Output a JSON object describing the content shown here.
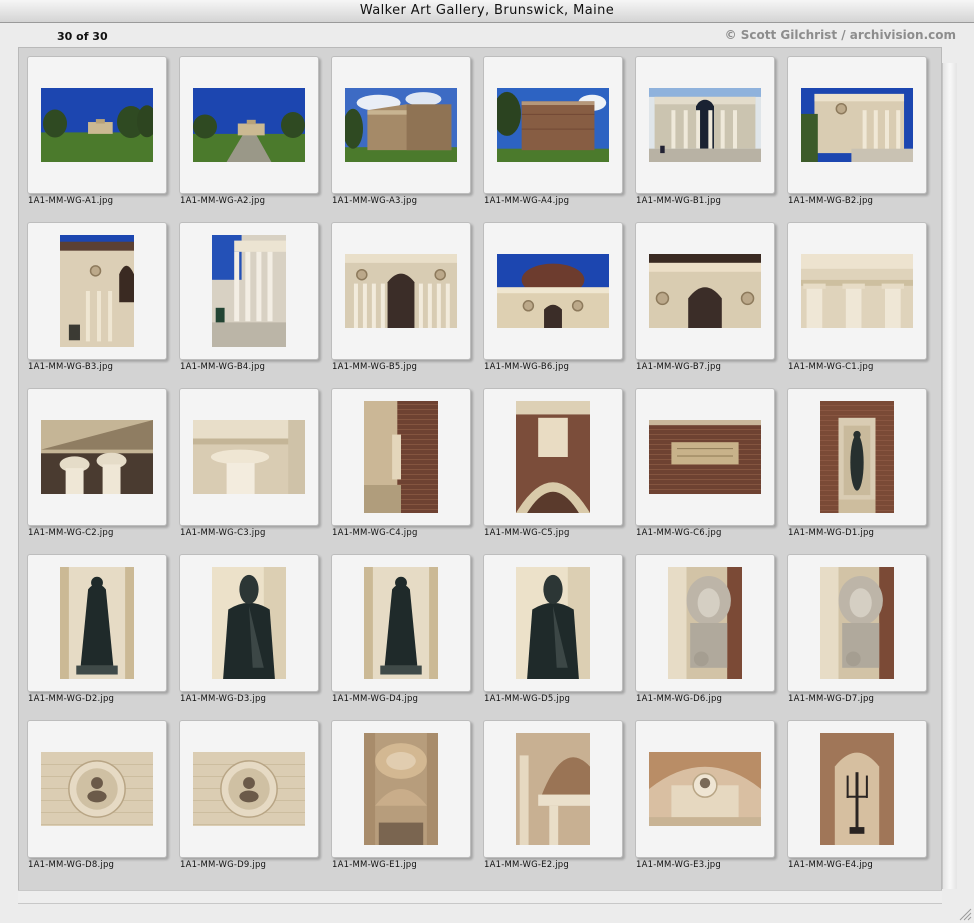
{
  "window": {
    "title": "Walker Art Gallery, Brunswick, Maine"
  },
  "info": {
    "count": "30 of 30",
    "credit": "© Scott Gilchrist / archivision.com"
  },
  "items": [
    {
      "name": "1A1-MM-WG-A1.jpg",
      "orientation": "landscape",
      "subject": "building-distant"
    },
    {
      "name": "1A1-MM-WG-A2.jpg",
      "orientation": "landscape",
      "subject": "building-distant-path"
    },
    {
      "name": "1A1-MM-WG-A3.jpg",
      "orientation": "landscape",
      "subject": "building-corner"
    },
    {
      "name": "1A1-MM-WG-A4.jpg",
      "orientation": "landscape",
      "subject": "building-side"
    },
    {
      "name": "1A1-MM-WG-B1.jpg",
      "orientation": "landscape",
      "subject": "portico-front"
    },
    {
      "name": "1A1-MM-WG-B2.jpg",
      "orientation": "landscape",
      "subject": "portico-angle"
    },
    {
      "name": "1A1-MM-WG-B3.jpg",
      "orientation": "portrait",
      "subject": "portico-side"
    },
    {
      "name": "1A1-MM-WG-B4.jpg",
      "orientation": "portrait",
      "subject": "columns-steps"
    },
    {
      "name": "1A1-MM-WG-B5.jpg",
      "orientation": "landscape",
      "subject": "portico-detail"
    },
    {
      "name": "1A1-MM-WG-B6.jpg",
      "orientation": "landscape",
      "subject": "dome-facade"
    },
    {
      "name": "1A1-MM-WG-B7.jpg",
      "orientation": "landscape",
      "subject": "facade-medallions"
    },
    {
      "name": "1A1-MM-WG-C1.jpg",
      "orientation": "landscape",
      "subject": "capitals"
    },
    {
      "name": "1A1-MM-WG-C2.jpg",
      "orientation": "landscape",
      "subject": "ionic-pair"
    },
    {
      "name": "1A1-MM-WG-C3.jpg",
      "orientation": "landscape",
      "subject": "ionic-single"
    },
    {
      "name": "1A1-MM-WG-C4.jpg",
      "orientation": "portrait",
      "subject": "brick-corner"
    },
    {
      "name": "1A1-MM-WG-C5.jpg",
      "orientation": "portrait",
      "subject": "keystone"
    },
    {
      "name": "1A1-MM-WG-C6.jpg",
      "orientation": "landscape",
      "subject": "brick-plaque"
    },
    {
      "name": "1A1-MM-WG-D1.jpg",
      "orientation": "portrait",
      "subject": "niche-statue"
    },
    {
      "name": "1A1-MM-WG-D2.jpg",
      "orientation": "portrait",
      "subject": "statue-robed"
    },
    {
      "name": "1A1-MM-WG-D3.jpg",
      "orientation": "portrait",
      "subject": "statue-close"
    },
    {
      "name": "1A1-MM-WG-D4.jpg",
      "orientation": "portrait",
      "subject": "statue-robed"
    },
    {
      "name": "1A1-MM-WG-D5.jpg",
      "orientation": "portrait",
      "subject": "statue-close"
    },
    {
      "name": "1A1-MM-WG-D6.jpg",
      "orientation": "portrait",
      "subject": "lion"
    },
    {
      "name": "1A1-MM-WG-D7.jpg",
      "orientation": "portrait",
      "subject": "lion"
    },
    {
      "name": "1A1-MM-WG-D8.jpg",
      "orientation": "landscape",
      "subject": "roundel-bust"
    },
    {
      "name": "1A1-MM-WG-D9.jpg",
      "orientation": "landscape",
      "subject": "roundel-bust"
    },
    {
      "name": "1A1-MM-WG-E1.jpg",
      "orientation": "portrait",
      "subject": "vault"
    },
    {
      "name": "1A1-MM-WG-E2.jpg",
      "orientation": "portrait",
      "subject": "arches"
    },
    {
      "name": "1A1-MM-WG-E3.jpg",
      "orientation": "landscape",
      "subject": "lunette-bust"
    },
    {
      "name": "1A1-MM-WG-E4.jpg",
      "orientation": "portrait",
      "subject": "niche-candelabra"
    }
  ],
  "colors": {
    "sky": "#1c46b0",
    "grass": "#4b7a2c",
    "brick": "#7a4a36",
    "stone": "#e2d2b4",
    "bronze": "#1f2a2a",
    "card": "#f4f4f4"
  }
}
